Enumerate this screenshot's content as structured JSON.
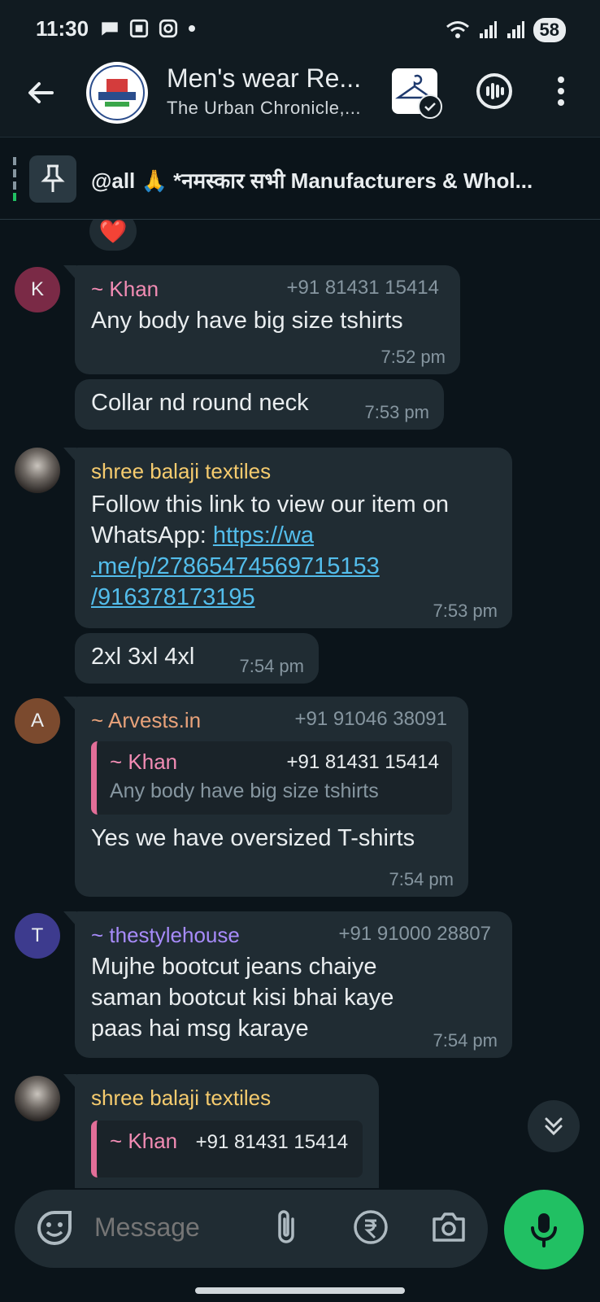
{
  "status_bar": {
    "time": "11:30",
    "battery": "58"
  },
  "header": {
    "title": "Men's wear Re...",
    "subtitle": "The Urban Chronicle,..."
  },
  "pinned": {
    "text": "@all 🙏 *नमस्कार सभी Manufacturers & Whol..."
  },
  "reaction": "❤️",
  "messages": [
    {
      "avatar_letter": "K",
      "avatar_color": "#7a2a46",
      "sender": "~ Khan",
      "sender_color": "#f28cb4",
      "phone": "+91 81431 15414",
      "text": "Any body have big size tshirts",
      "time": "7:52 pm"
    },
    {
      "text": "Collar nd round neck",
      "time": "7:53 pm"
    },
    {
      "sender": "shree balaji textiles",
      "sender_color": "#f5cb6e",
      "text_prefix": "Follow this link to view our item on WhatsApp: ",
      "link_line1": "https://wa",
      "link_line2": ".me/p/27865474569715153",
      "link_line3": "/916378173195",
      "time": "7:53 pm"
    },
    {
      "text": "2xl 3xl 4xl",
      "time": "7:54 pm"
    },
    {
      "avatar_letter": "A",
      "avatar_color": "#7b4a2e",
      "sender": "~ Arvests.in",
      "sender_color": "#e8a27a",
      "phone": "+91 91046 38091",
      "quote_name": "~ Khan",
      "quote_phone": "+91 81431 15414",
      "quote_text": "Any body have big size tshirts",
      "text": "Yes we have oversized T-shirts",
      "time": "7:54 pm"
    },
    {
      "avatar_letter": "T",
      "avatar_color": "#3d3b8e",
      "sender": "~ thestylehouse",
      "sender_color": "#a78bfa",
      "phone": "+91 91000 28807",
      "line1": "Mujhe bootcut jeans chaiye",
      "line2": "saman bootcut kisi bhai kaye",
      "line3": "paas hai msg karaye",
      "time": "7:54 pm"
    },
    {
      "sender": "shree balaji textiles",
      "sender_color": "#f5cb6e",
      "quote_name": "~ Khan",
      "quote_phone": "+91 81431 15414"
    }
  ],
  "input": {
    "placeholder": "Message"
  },
  "colors": {
    "accent": "#21c063",
    "background": "#0b141a",
    "bubble": "#202c33"
  }
}
